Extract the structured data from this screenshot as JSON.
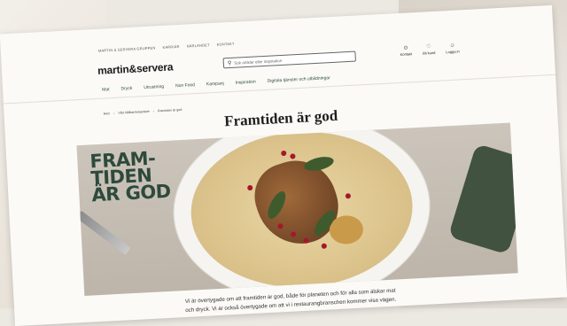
{
  "top_links": [
    "MARTIN & SERVERA GRUPPEN",
    "KARRIÄR",
    "NÄRLANDET",
    "KONTAKT"
  ],
  "brand": {
    "logo": "martin&servera"
  },
  "search": {
    "placeholder": "Sök artiklar eller inspiration"
  },
  "utilities": [
    {
      "icon": "location-icon",
      "label": "Kontakt"
    },
    {
      "icon": "heart-icon",
      "label": "Bli kund"
    },
    {
      "icon": "user-icon",
      "label": "Logga in"
    }
  ],
  "main_nav": [
    "Mat",
    "Dryck",
    "Utrustning",
    "Non Food",
    "Kampanj",
    "Inspiration",
    "Digitala tjänster och utbildningar"
  ],
  "breadcrumb": [
    "Hem",
    "Vårt hållbarhetsarbete",
    "Framtiden är god"
  ],
  "page_title": "Framtiden är god",
  "hero": {
    "lines": [
      "FRAM-",
      "TIDEN",
      "ÄR GOD"
    ]
  },
  "intro": {
    "line1": "Vi är övertygade om att framtiden är god, både för planeten och för alla som älskar mat",
    "line2": "och dryck. Vi är också övertygade om att vi i restaurangbranschen kommer visa vägen."
  },
  "colors": {
    "brand_green": "#2d4a3c",
    "page_bg": "#fbfaf7"
  }
}
